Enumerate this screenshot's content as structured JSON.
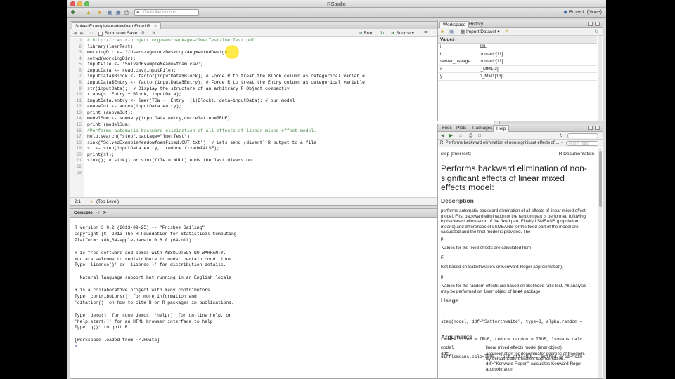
{
  "window": {
    "title": "RStudio"
  },
  "toolbar": {
    "goto_placeholder": "Go to file/function",
    "project_label": "Project: (None)"
  },
  "editor": {
    "tab_label": "SolvedExampleMeadowfoamFixed.R",
    "source_on_save": "Source on Save",
    "run_label": "Run",
    "source_label": "Source",
    "lines": [
      "# http://cran.r-project.org/web/packages/lmerTest/lmerTest.pdf",
      "library(lmerTest)",
      "workingDir <- '/Users/agurun/Desktop/AugmentedDesign';",
      "setwd(workingDir);",
      "inputFile <- 'SolvedExampleMeadowfoam.csv';",
      "inputData <- read.csv(inputFile);",
      "inputData$Block <- factor(inputData$Block); # Force R to treat the Block column as categorical variable",
      "inputData$Entry <- factor(inputData$Entry); # Force R to treat the Entry column as categorical variable",
      "str(inputData);  # Display the structure of an arbitrary R Object compactly",
      "xtabs(~  Entry + Block, inputData);",
      "inputData.entry <- lmer(TSW ~  Entry +(1|Block), data=inputData); # our model",
      "anovaOut <- anova(inputData.entry);",
      "print (anovaOut);",
      "modelSum <- summary(inputData.entry,correlation=TRUE)",
      "print (modelSum)",
      "#Performs automatic backward elimination of all effects of linear mixed effect model.",
      "help.search(\"step\",package=\"lmerTest\");",
      "sink(\"SolvedExampleMeadowfoamFixed.OUT.txt\"); # Lets send (divert) R output to a file",
      "st <- step(inputData.entry,  reduce.fixed=FALSE);",
      "print(st);",
      "sink(); # sink() or sink(file = NULL) ends the last diversion.",
      "",
      ""
    ],
    "status_pos": "2:1",
    "status_scope": "(Top Level)",
    "status_type": "R Script"
  },
  "console": {
    "title": "Console",
    "path": "~/",
    "lines": [
      "R version 3.0.2 (2013-09-25) -- \"Frisbee Sailing\"",
      "Copyright (C) 2013 The R Foundation for Statistical Computing",
      "Platform: x86_64-apple-darwin10.8.0 (64-bit)",
      "",
      "R is free software and comes with ABSOLUTELY NO WARRANTY.",
      "You are welcome to redistribute it under certain conditions.",
      "Type 'license()' or 'licence()' for distribution details.",
      "",
      "  Natural language support but running in an English locale",
      "",
      "R is a collaborative project with many contributors.",
      "Type 'contributors()' for more information and",
      "'citation()' on how to cite R or R packages in publications.",
      "",
      "Type 'demo()' for some demos, 'help()' for on-line help, or",
      "'help.start()' for an HTML browser interface to help.",
      "Type 'q()' to quit R.",
      "",
      "[Workspace loaded from ~/.RData]",
      "",
      ""
    ],
    "prompt": ">"
  },
  "workspace": {
    "tabs": [
      "Workspace",
      "History"
    ],
    "import_label": "Import Dataset",
    "section": "Values",
    "rows": [
      {
        "name": "i",
        "value": "11L"
      },
      {
        "name": "l",
        "value": "numeric[11]"
      },
      {
        "name": "server_useage",
        "value": "numeric[11]"
      },
      {
        "name": "x",
        "value": "i_MM1[3]"
      },
      {
        "name": "y",
        "value": "o_MM1[13]"
      }
    ]
  },
  "help": {
    "tabs": [
      "Files",
      "Plots",
      "Packages",
      "Help"
    ],
    "topic_select": "R: Performs backward elimination of non-significant effects of ...",
    "find_placeholder": "Find in Topic",
    "page_func": "step {lmerTest}",
    "page_doc": "R Documentation",
    "title": "Performs backward elimination of non-significant effects of linear mixed effects model:",
    "desc_heading": "Description",
    "desc_text": "performs automatic backward elimination of all effects of linear mixed effect model. First backward elimination of the random part is performed following by backward elimination of the fixed part. Finally LSMEANS (population means) and differences of LSMEANS for the fixed part of the model are calculated and the final model is provided. The",
    "p1": "p",
    "p1_text": "-values for the fixed effects are calculated from",
    "F": "F",
    "F_text": "test based on Sattethwaite's or Kenward-Roger approximation),",
    "p2": "p",
    "p2_text_a": "-values for the random effects are based on likelihood ratio test. All analysis may be performed on ",
    "p2_code": "lmer",
    "p2_text_b": " object of ",
    "p2_bold": "lme4",
    "p2_text_c": " package.",
    "usage_heading": "Usage",
    "usage_lines": [
      "step(model, ddf=\"Satterthwaite\", type=3, alpha.random =",
      "reduce.fixed = TRUE, reduce.random = TRUE, lsmeans.calc",
      "difflsmeans.calc=TRUE, test.effs=NULL, method.grad=\"sim"
    ],
    "args_heading": "Arguments",
    "arg1_name": "model",
    "arg1_desc": "linear mixed effects model (lmer object).",
    "arg2_name": "ddf",
    "arg2_desc": "approximation for denominator degrees of freedom. By default Satterthwaite's approximation. ddf=\"Kenward-Roger\"\" calculates Kenward-Roger approximation"
  }
}
